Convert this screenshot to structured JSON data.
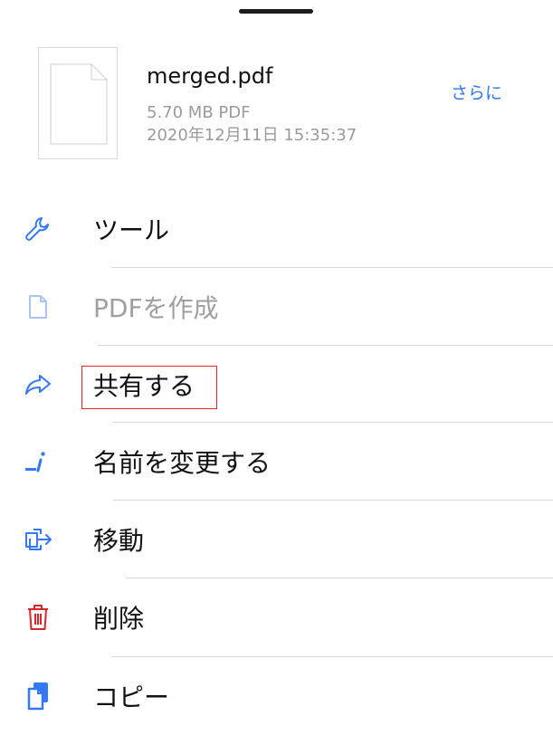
{
  "file": {
    "name": "merged.pdf",
    "size_type": "5.70 MB PDF",
    "date": "2020年12月11日 15:35:37",
    "more_label": "さらに"
  },
  "menu": {
    "items": [
      {
        "label": "ツール",
        "icon": "wrench-icon",
        "enabled": true
      },
      {
        "label": "PDFを作成",
        "icon": "document-icon",
        "enabled": false
      },
      {
        "label": "共有する",
        "icon": "share-arrow-icon",
        "enabled": true
      },
      {
        "label": "名前を変更する",
        "icon": "rename-cursor-icon",
        "enabled": true
      },
      {
        "label": "移動",
        "icon": "move-icon",
        "enabled": true
      },
      {
        "label": "削除",
        "icon": "trash-icon",
        "enabled": true
      },
      {
        "label": "コピー",
        "icon": "copy-icon",
        "enabled": true
      }
    ]
  },
  "colors": {
    "accent": "#3478f6",
    "delete": "#d9262a",
    "disabled": "#a0a0a0",
    "highlight_box": "#e0262b"
  }
}
